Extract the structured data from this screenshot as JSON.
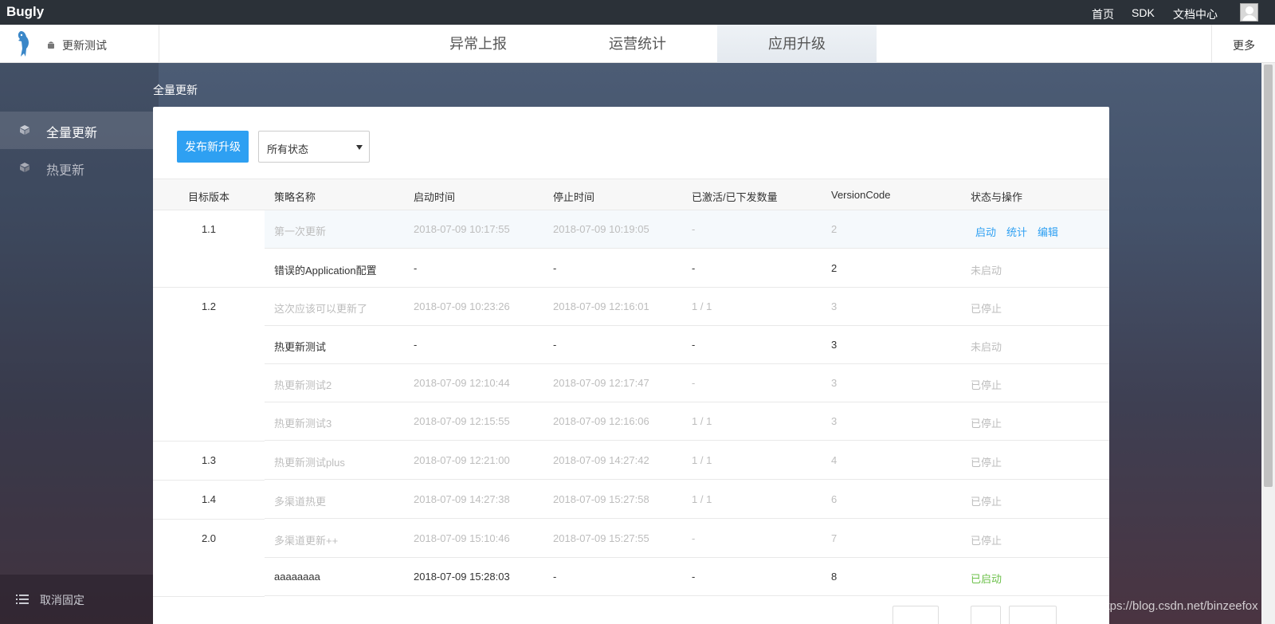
{
  "topbar": {
    "brand": "Bugly",
    "links": [
      "首页",
      "SDK",
      "文档中心"
    ]
  },
  "header": {
    "app_name": "更新测试",
    "tabs": [
      {
        "label": "异常上报"
      },
      {
        "label": "运营统计"
      },
      {
        "label": "应用升级"
      }
    ],
    "more": "更多"
  },
  "sidebar": {
    "items": [
      {
        "label": "全量更新",
        "active": true
      },
      {
        "label": "热更新",
        "active": false
      }
    ],
    "footer": "取消固定"
  },
  "breadcrumb": "全量更新",
  "toolbar": {
    "publish": "发布新升级",
    "status_filter": "所有状态"
  },
  "table": {
    "columns": [
      "目标版本",
      "策略名称",
      "启动时间",
      "停止时间",
      "已激活/已下发数量",
      "VersionCode",
      "状态与操作"
    ],
    "versions": [
      "1.1",
      "1.2",
      "1.3",
      "1.4",
      "2.0"
    ],
    "rows": [
      {
        "name": "第一次更新",
        "start": "2018-07-09 10:17:55",
        "stop": "2018-07-09 10:19:05",
        "count": "-",
        "code": "2",
        "actions": [
          "启动",
          "统计",
          "编辑"
        ]
      },
      {
        "name": "错误的Application配置",
        "start": "-",
        "stop": "-",
        "count": "-",
        "code": "2",
        "status": "未启动"
      },
      {
        "name": "这次应该可以更新了",
        "start": "2018-07-09 10:23:26",
        "stop": "2018-07-09 12:16:01",
        "count": "1 / 1",
        "code": "3",
        "status": "已停止"
      },
      {
        "name": "热更新测试",
        "start": "-",
        "stop": "-",
        "count": "-",
        "code": "3",
        "status": "未启动"
      },
      {
        "name": "热更新测试2",
        "start": "2018-07-09 12:10:44",
        "stop": "2018-07-09 12:17:47",
        "count": "-",
        "code": "3",
        "status": "已停止"
      },
      {
        "name": "热更新测试3",
        "start": "2018-07-09 12:15:55",
        "stop": "2018-07-09 12:16:06",
        "count": "1 / 1",
        "code": "3",
        "status": "已停止"
      },
      {
        "name": "热更新测试plus",
        "start": "2018-07-09 12:21:00",
        "stop": "2018-07-09 14:27:42",
        "count": "1 / 1",
        "code": "4",
        "status": "已停止"
      },
      {
        "name": "多渠道热更",
        "start": "2018-07-09 14:27:38",
        "stop": "2018-07-09 15:27:58",
        "count": "1 / 1",
        "code": "6",
        "status": "已停止"
      },
      {
        "name": "多渠道更新++",
        "start": "2018-07-09 15:10:46",
        "stop": "2018-07-09 15:27:55",
        "count": "-",
        "code": "7",
        "status": "已停止"
      },
      {
        "name": "aaaaaaaa",
        "start": "2018-07-09 15:28:03",
        "stop": "-",
        "count": "-",
        "code": "8",
        "status": "已启动"
      }
    ]
  },
  "watermark": "https://blog.csdn.net/binzeefox",
  "colors": {
    "accent": "#2ea0f2",
    "active_status": "#6cc04a",
    "muted": "#bdbdbd"
  }
}
